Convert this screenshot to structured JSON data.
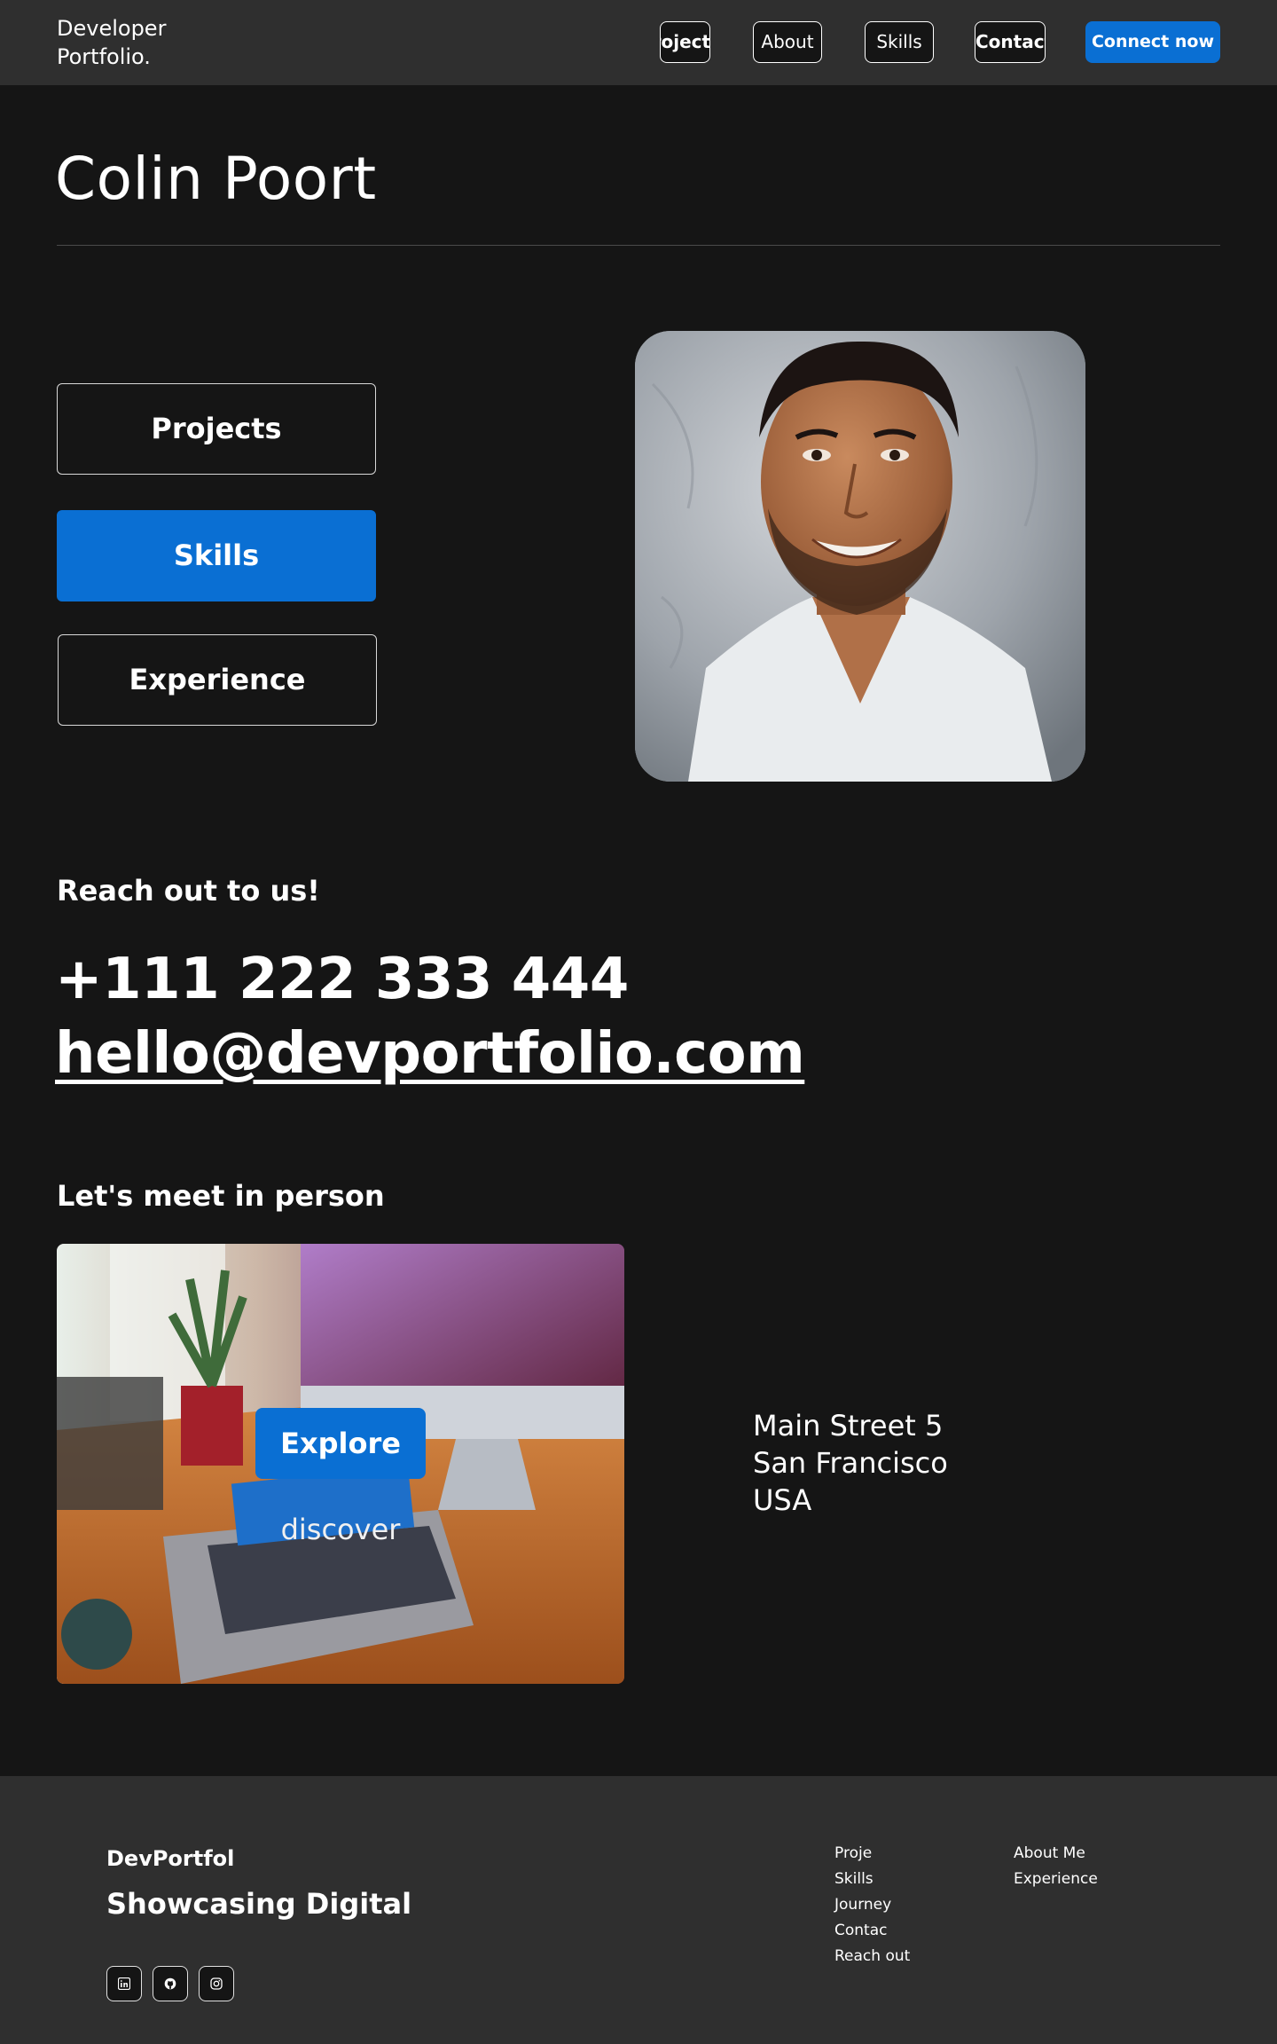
{
  "navbar": {
    "brand_line1": "Developer",
    "brand_line2": "Portfolio.",
    "links": [
      "Projects",
      "About",
      "Skills",
      "Contact"
    ],
    "cta": "Connect now"
  },
  "hero": {
    "name": "Colin Poort",
    "buttons": [
      "Projects",
      "Skills",
      "Experience"
    ],
    "active_button": "Skills"
  },
  "contact": {
    "title": "Reach out to us!",
    "phone": "+111 222 333 444",
    "email": "hello@devportfolio.com"
  },
  "meet": {
    "title": "Let's meet in person",
    "explore_label": "Explore",
    "discover_label": "discover",
    "address_line1": "Main Street 5",
    "address_line2": "San Francisco",
    "address_line3": "USA"
  },
  "footer": {
    "brand": "DevPortfol",
    "tagline": "Showcasing Digital",
    "social_icons": [
      "linkedin-icon",
      "github-icon",
      "instagram-icon"
    ],
    "col1": [
      "Proje",
      "Skills",
      "Journey",
      "Contac",
      "Reach out"
    ],
    "col2": [
      "About Me",
      "Experience"
    ]
  },
  "colors": {
    "background": "#151515",
    "surface": "#2f2f2f",
    "accent": "#0a6fd3"
  }
}
